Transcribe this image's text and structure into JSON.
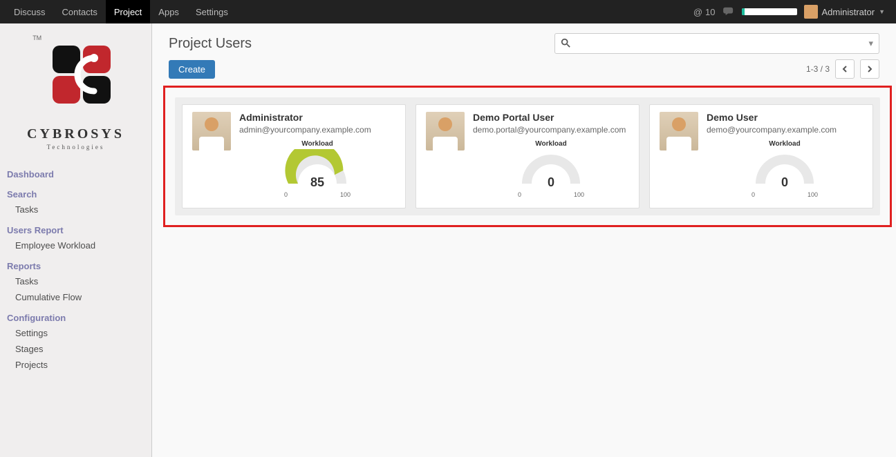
{
  "topnav": {
    "items": [
      {
        "label": "Discuss",
        "active": false
      },
      {
        "label": "Contacts",
        "active": false
      },
      {
        "label": "Project",
        "active": true
      },
      {
        "label": "Apps",
        "active": false
      },
      {
        "label": "Settings",
        "active": false
      }
    ],
    "mention_count": "10",
    "user_label": "Administrator"
  },
  "brand": {
    "name": "CYBROSYS",
    "sub": "Technologies",
    "tm": "TM"
  },
  "sidebar": {
    "groups": [
      {
        "header": "Dashboard",
        "links": []
      },
      {
        "header": "Search",
        "links": [
          "Tasks"
        ]
      },
      {
        "header": "Users Report",
        "links": [
          "Employee Workload"
        ]
      },
      {
        "header": "Reports",
        "links": [
          "Tasks",
          "Cumulative Flow"
        ]
      },
      {
        "header": "Configuration",
        "links": [
          "Settings",
          "Stages",
          "Projects"
        ]
      }
    ]
  },
  "page": {
    "title": "Project Users",
    "search_placeholder": "",
    "create_label": "Create",
    "pager_text": "1-3 / 3"
  },
  "cards": [
    {
      "name": "Administrator",
      "email": "admin@yourcompany.example.com",
      "workload_label": "Workload",
      "value": 85,
      "scale_min": "0",
      "scale_max": "100",
      "fill": "#b3c833"
    },
    {
      "name": "Demo Portal User",
      "email": "demo.portal@yourcompany.example.com",
      "workload_label": "Workload",
      "value": 0,
      "scale_min": "0",
      "scale_max": "100",
      "fill": "#b3c833"
    },
    {
      "name": "Demo User",
      "email": "demo@yourcompany.example.com",
      "workload_label": "Workload",
      "value": 0,
      "scale_min": "0",
      "scale_max": "100",
      "fill": "#b3c833"
    }
  ]
}
